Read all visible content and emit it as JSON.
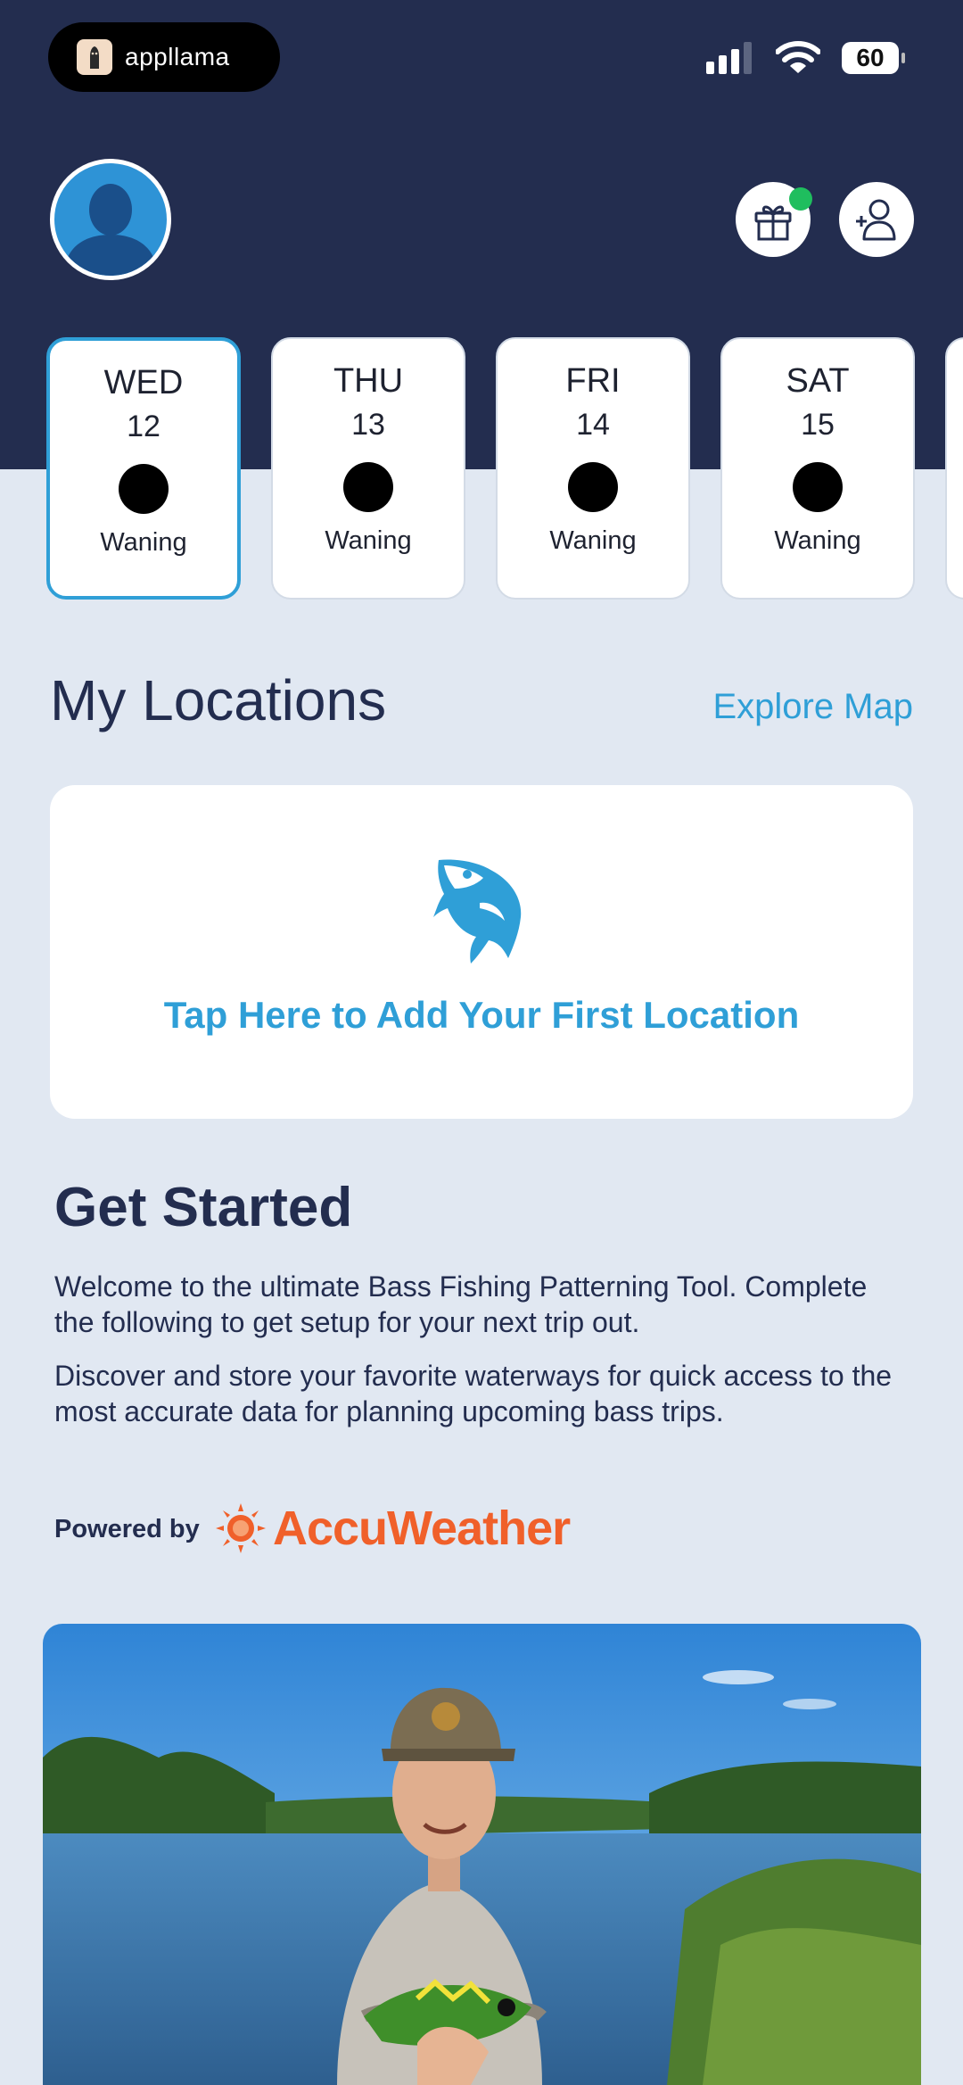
{
  "status_bar": {
    "app_pill_label": "appllama",
    "battery": "60"
  },
  "days": [
    {
      "name": "WED",
      "date": "12",
      "phase": "Waning",
      "selected": true
    },
    {
      "name": "THU",
      "date": "13",
      "phase": "Waning",
      "selected": false
    },
    {
      "name": "FRI",
      "date": "14",
      "phase": "Waning",
      "selected": false
    },
    {
      "name": "SAT",
      "date": "15",
      "phase": "Waning",
      "selected": false
    }
  ],
  "locations": {
    "title": "My Locations",
    "explore_link": "Explore Map",
    "add_label": "Tap Here to Add Your First Location"
  },
  "get_started": {
    "title": "Get Started",
    "para1": "Welcome to the ultimate Bass Fishing Patterning Tool. Complete the following to get setup for your next trip out.",
    "para2": "Discover and store your favorite waterways for quick access to the most accurate data for planning upcoming bass trips."
  },
  "powered": {
    "label": "Powered by",
    "brand": "AccuWeather"
  },
  "colors": {
    "header": "#232d4f",
    "accent": "#2f9fd7",
    "brand_orange": "#f0602a",
    "notification": "#1fbe5e"
  }
}
